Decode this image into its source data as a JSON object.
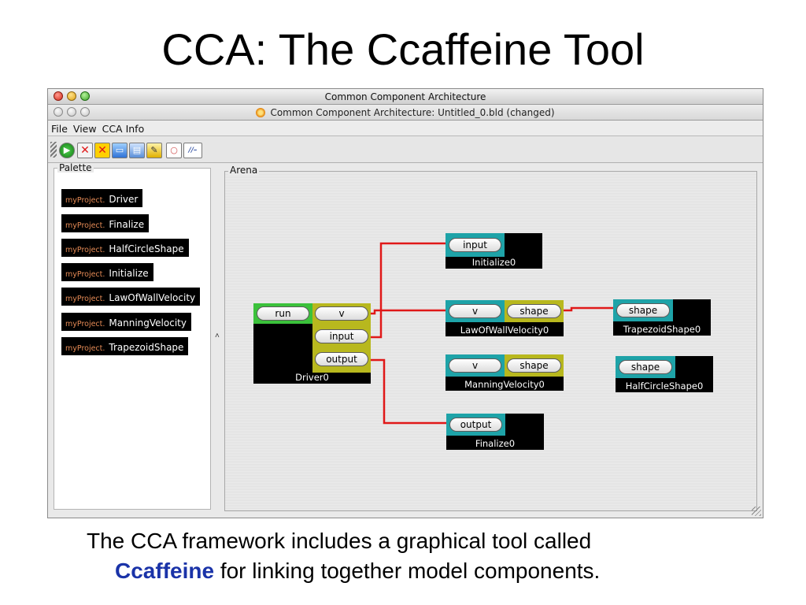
{
  "slide": {
    "title": "CCA:  The Ccaffeine Tool",
    "caption_line1": "The CCA framework includes a graphical tool called",
    "caption_highlight": "Ccaffeine",
    "caption_line2_rest": " for linking together model components."
  },
  "window": {
    "outer_title": "Common Component Architecture",
    "inner_title": "Common Component Architecture: Untitled_0.bld (changed)"
  },
  "menu": {
    "file": "File",
    "view": "View",
    "cca_info": "CCA Info"
  },
  "toolbar": {
    "buttons": [
      "run-icon",
      "delete-icon",
      "delete-all-icon",
      "open-icon",
      "save-icon",
      "edit-icon",
      "search-icon",
      "window-icon"
    ]
  },
  "palette": {
    "label": "Palette",
    "prefix": "myProject.",
    "items": [
      "Driver",
      "Finalize",
      "HalfCircleShape",
      "Initialize",
      "LawOfWallVelocity",
      "ManningVelocity",
      "TrapezoidShape"
    ]
  },
  "arena": {
    "label": "Arena",
    "components": {
      "driver": {
        "name": "Driver0",
        "provides": [
          "run"
        ],
        "uses": [
          "v",
          "input",
          "output"
        ]
      },
      "initialize": {
        "name": "Initialize0",
        "provides": [
          "input"
        ]
      },
      "lawofwall": {
        "name": "LawOfWallVelocity0",
        "provides": [
          "v"
        ],
        "uses": [
          "shape"
        ]
      },
      "manning": {
        "name": "ManningVelocity0",
        "provides": [
          "v"
        ],
        "uses": [
          "shape"
        ]
      },
      "trapezoid": {
        "name": "TrapezoidShape0",
        "provides": [
          "shape"
        ]
      },
      "halfcircle": {
        "name": "HalfCircleShape0",
        "provides": [
          "shape"
        ]
      },
      "finalize": {
        "name": "Finalize0",
        "provides": [
          "output"
        ]
      }
    },
    "wire_color": "#e01818"
  },
  "colors": {
    "provides_port": "#1ea3a8",
    "uses_port": "#b8b81e",
    "go_port": "#3bc13b",
    "highlight": "#1a33a8"
  }
}
